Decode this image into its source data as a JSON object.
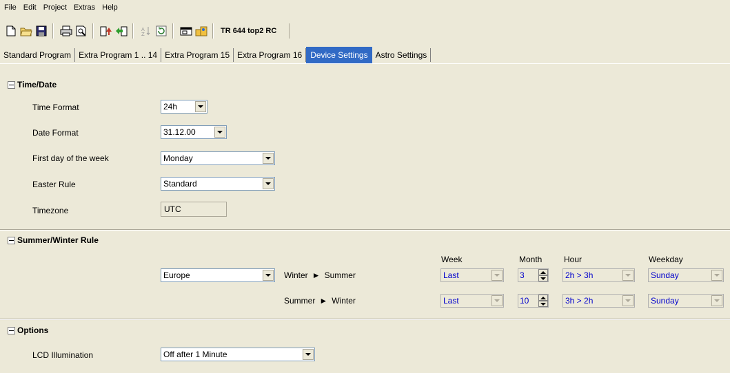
{
  "menu": [
    "File",
    "Edit",
    "Project",
    "Extras",
    "Help"
  ],
  "toolbar": {
    "device_title": "TR 644 top2 RC",
    "icons": [
      "new-icon",
      "open-icon",
      "save-icon",
      "print-icon",
      "print-preview-icon",
      "upload-icon",
      "download-icon",
      "sort-icon",
      "refresh-icon",
      "window-icon",
      "users-icon"
    ]
  },
  "tabs": [
    "Standard Program",
    "Extra Program 1 .. 14",
    "Extra Program 15",
    "Extra Program 16",
    "Device Settings",
    "Astro Settings"
  ],
  "active_tab": "Device Settings",
  "time_date": {
    "header": "Time/Date",
    "time_format": {
      "label": "Time Format",
      "value": "24h"
    },
    "date_format": {
      "label": "Date Format",
      "value": "31.12.00"
    },
    "first_day": {
      "label": "First day of the week",
      "value": "Monday"
    },
    "easter_rule": {
      "label": "Easter Rule",
      "value": "Standard"
    },
    "timezone": {
      "label": "Timezone",
      "value": "UTC"
    }
  },
  "summer_winter": {
    "header": "Summer/Winter Rule",
    "region": "Europe",
    "columns": {
      "week": "Week",
      "month": "Month",
      "hour": "Hour",
      "weekday": "Weekday"
    },
    "rows": [
      {
        "from": "Winter",
        "to": "Summer",
        "week": "Last",
        "month": "3",
        "hour": "2h > 3h",
        "weekday": "Sunday"
      },
      {
        "from": "Summer",
        "to": "Winter",
        "week": "Last",
        "month": "10",
        "hour": "3h > 2h",
        "weekday": "Sunday"
      }
    ]
  },
  "options": {
    "header": "Options",
    "lcd": {
      "label": "LCD Illumination",
      "value": "Off after 1 Minute"
    }
  },
  "colors": {
    "active_tab": "#316ac5",
    "disabled_text": "#0000cc",
    "background": "#ece9d8"
  }
}
